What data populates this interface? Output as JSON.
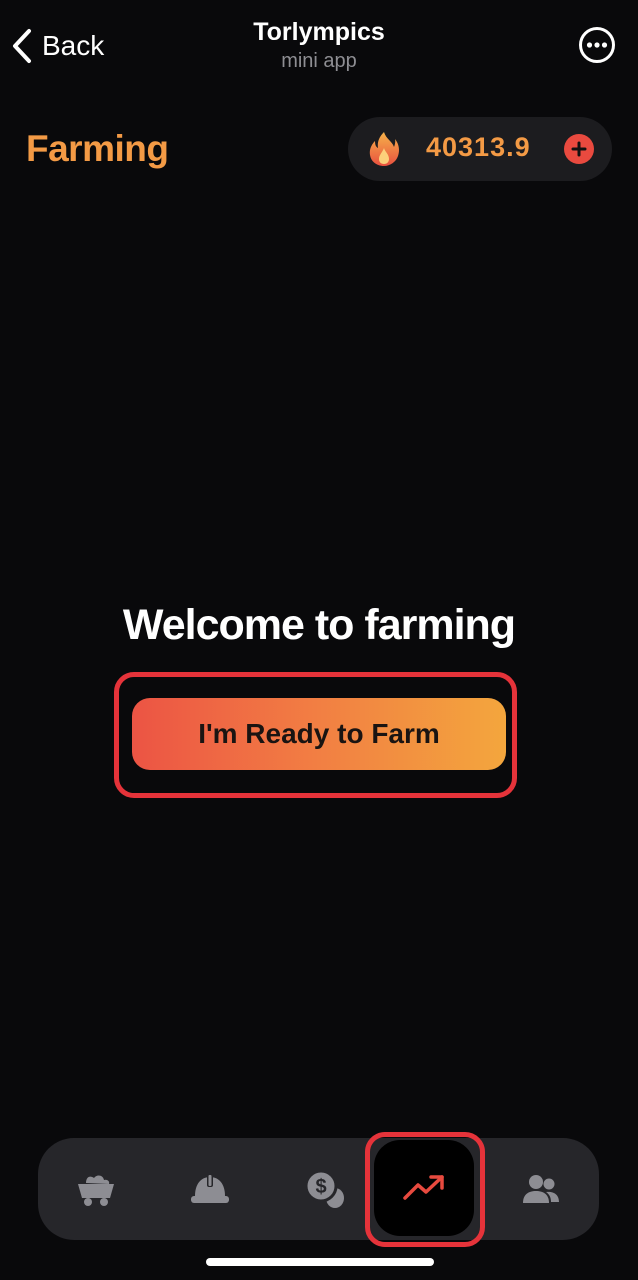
{
  "header": {
    "back_label": "Back",
    "title": "Torlympics",
    "subtitle": "mini app"
  },
  "page": {
    "section_title": "Farming",
    "balance": "40313.9",
    "welcome_text": "Welcome to farming",
    "ready_button_label": "I'm Ready to Farm"
  },
  "nav": {
    "items": [
      {
        "icon": "mine-cart-icon",
        "active": false
      },
      {
        "icon": "hard-hat-icon",
        "active": false
      },
      {
        "icon": "coins-icon",
        "active": false
      },
      {
        "icon": "trending-up-icon",
        "active": true
      },
      {
        "icon": "users-icon",
        "active": false
      }
    ]
  },
  "colors": {
    "background": "#09090b",
    "accent_orange": "#f39a45",
    "accent_red": "#e94a3f",
    "highlight_red": "#e5333a",
    "nav_bg": "#26262a"
  }
}
